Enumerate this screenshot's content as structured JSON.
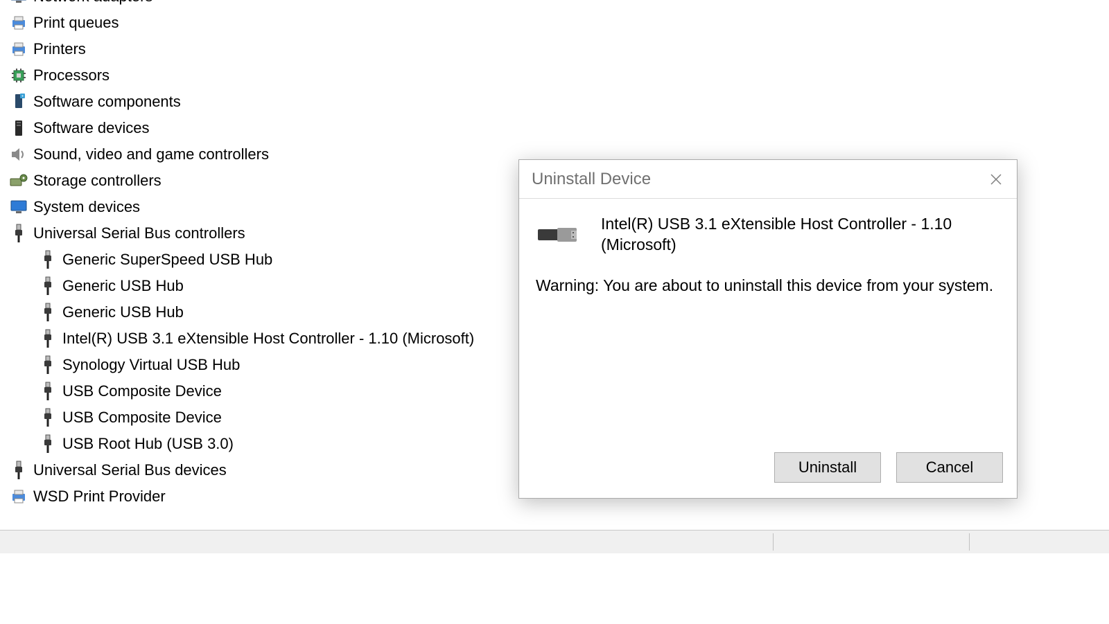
{
  "tree": {
    "categories": [
      {
        "icon": "monitor",
        "label": "Network adapters",
        "level": 1
      },
      {
        "icon": "printer",
        "label": "Print queues",
        "level": 1
      },
      {
        "icon": "printer",
        "label": "Printers",
        "level": 1
      },
      {
        "icon": "chip",
        "label": "Processors",
        "level": 1
      },
      {
        "icon": "component",
        "label": "Software components",
        "level": 1
      },
      {
        "icon": "tower",
        "label": "Software devices",
        "level": 1
      },
      {
        "icon": "speaker",
        "label": "Sound, video and game controllers",
        "level": 1
      },
      {
        "icon": "storage",
        "label": "Storage controllers",
        "level": 1
      },
      {
        "icon": "monitor",
        "label": "System devices",
        "level": 1
      },
      {
        "icon": "usb",
        "label": "Universal Serial Bus controllers",
        "level": 1
      },
      {
        "icon": "usbplug",
        "label": "Generic SuperSpeed USB Hub",
        "level": 2
      },
      {
        "icon": "usbplug",
        "label": "Generic USB Hub",
        "level": 2
      },
      {
        "icon": "usbplug",
        "label": "Generic USB Hub",
        "level": 2
      },
      {
        "icon": "usbplug",
        "label": "Intel(R) USB 3.1 eXtensible Host Controller - 1.10 (Microsoft)",
        "level": 2
      },
      {
        "icon": "usbplug",
        "label": "Synology Virtual USB Hub",
        "level": 2
      },
      {
        "icon": "usbplug",
        "label": "USB Composite Device",
        "level": 2
      },
      {
        "icon": "usbplug",
        "label": "USB Composite Device",
        "level": 2
      },
      {
        "icon": "usbplug",
        "label": "USB Root Hub (USB 3.0)",
        "level": 2
      },
      {
        "icon": "usb",
        "label": "Universal Serial Bus devices",
        "level": 1
      },
      {
        "icon": "printer",
        "label": "WSD Print Provider",
        "level": 1
      }
    ]
  },
  "dialog": {
    "title": "Uninstall Device",
    "device_name_line1": "Intel(R) USB 3.1 eXtensible Host Controller - 1.10",
    "device_name_line2": "(Microsoft)",
    "warning": "Warning: You are about to uninstall this device from your system.",
    "uninstall_label": "Uninstall",
    "cancel_label": "Cancel"
  }
}
